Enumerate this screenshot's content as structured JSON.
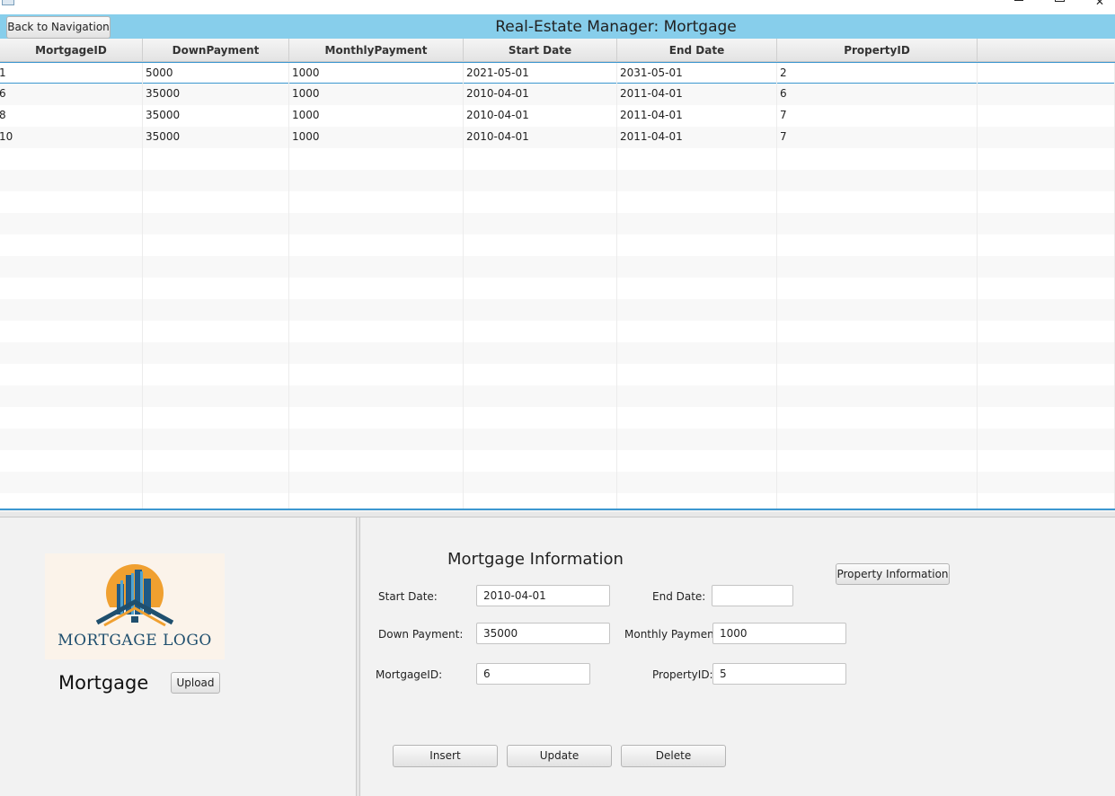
{
  "window": {
    "controls": {
      "minimize": "",
      "maximize": "",
      "close": "✕"
    }
  },
  "header": {
    "back_label": "Back to Navigation",
    "title": "Real-Estate Manager: Mortgage"
  },
  "table": {
    "columns": [
      "MortgageID",
      "DownPayment",
      "MonthlyPayment",
      "Start Date",
      "End Date",
      "PropertyID"
    ],
    "rows": [
      [
        "1",
        "5000",
        "1000",
        "2021-05-01",
        "2031-05-01",
        "2"
      ],
      [
        "6",
        "35000",
        "1000",
        "2010-04-01",
        "2011-04-01",
        "6"
      ],
      [
        "8",
        "35000",
        "1000",
        "2010-04-01",
        "2011-04-01",
        "7"
      ],
      [
        "10",
        "35000",
        "1000",
        "2010-04-01",
        "2011-04-01",
        "7"
      ]
    ]
  },
  "logo": {
    "text": "MORTGAGE LOGO"
  },
  "left": {
    "label": "Mortgage",
    "upload_label": "Upload"
  },
  "form": {
    "title": "Mortgage Information",
    "property_info_label": "Property Information",
    "start_date_label": "Start Date:",
    "start_date_value": "2010-04-01",
    "end_date_label": "End Date:",
    "end_date_value": "",
    "down_payment_label": "Down Payment:",
    "down_payment_value": "35000",
    "monthly_payment_label": "Monthly Payment:",
    "monthly_payment_value": "1000",
    "mortgage_id_label": "MortgageID:",
    "mortgage_id_value": "6",
    "property_id_label": "PropertyID:",
    "property_id_value": "5",
    "insert_label": "Insert",
    "update_label": "Update",
    "delete_label": "Delete"
  },
  "colors": {
    "header_bg": "#87ceeb",
    "selection_border": "#3c97d0",
    "logo_navy": "#1f4f6e",
    "logo_orange": "#f0a030"
  }
}
